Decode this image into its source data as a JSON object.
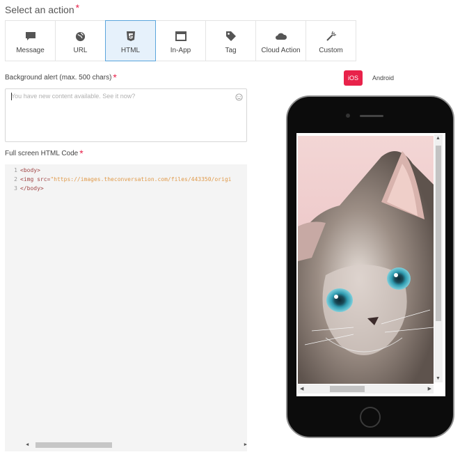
{
  "header": {
    "title": "Select an action",
    "required_mark": "*"
  },
  "actions": [
    {
      "label": "Message",
      "icon": "message-icon",
      "active": false
    },
    {
      "label": "URL",
      "icon": "globe-icon",
      "active": false
    },
    {
      "label": "HTML",
      "icon": "html5-icon",
      "active": true
    },
    {
      "label": "In-App",
      "icon": "window-icon",
      "active": false
    },
    {
      "label": "Tag",
      "icon": "tag-icon",
      "active": false
    },
    {
      "label": "Cloud Action",
      "icon": "cloud-icon",
      "active": false
    },
    {
      "label": "Custom",
      "icon": "magic-wand-icon",
      "active": false
    }
  ],
  "background_alert": {
    "label": "Background alert (max. 500 chars)",
    "required_mark": "*",
    "placeholder": "You have new content available. See it now?",
    "value": ""
  },
  "html_code": {
    "label": "Full screen HTML Code",
    "required_mark": "*",
    "lines": [
      {
        "num": "1",
        "text": "<body>"
      },
      {
        "num": "2",
        "tag_open": "<img ",
        "attr": "src=",
        "str": "\"https://images.theconversation.com/files/443350/origi"
      },
      {
        "num": "3",
        "text": "</body>"
      }
    ]
  },
  "preview": {
    "tabs": [
      {
        "label": "iOS",
        "active": true
      },
      {
        "label": "Android",
        "active": false
      }
    ]
  },
  "colors": {
    "accent": "#e8224a",
    "selected_bg": "#e6f1fb",
    "selected_border": "#5aa5dc"
  }
}
